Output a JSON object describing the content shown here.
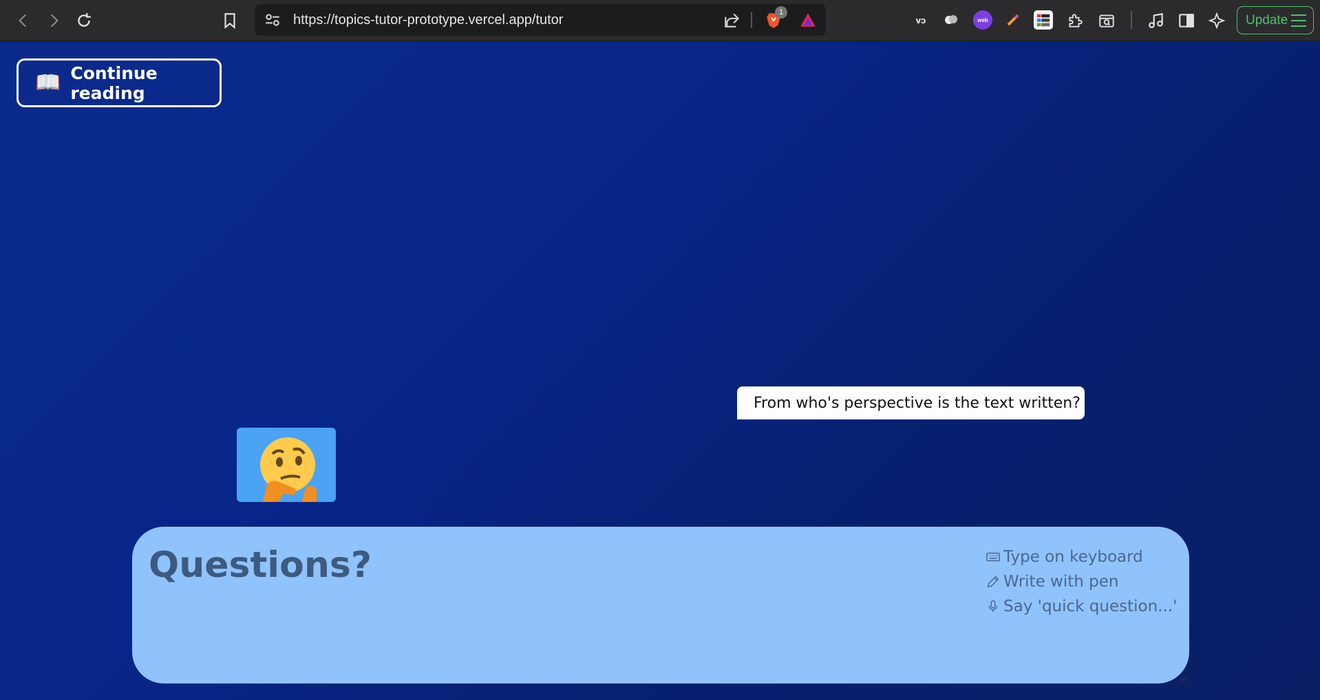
{
  "browser": {
    "url": "https://topics-tutor-prototype.vercel.app/tutor",
    "shields_badge": "1",
    "extensions": [
      "vd-icon",
      "cloud-extension-icon",
      "web-to-figma-icon",
      "color-picker-icon",
      "app-grid-extension-icon",
      "puzzle-extensions-icon",
      "screenshot-search-icon"
    ],
    "update_label": "Update"
  },
  "page": {
    "continue_label": "Continue reading",
    "chat_bubble": "From who's perspective is the text written?",
    "avatar_emoji": "🤔",
    "question_placeholder": "Questions?",
    "input_hints": [
      {
        "icon": "keyboard-icon",
        "label": "Type on keyboard"
      },
      {
        "icon": "pen-icon",
        "label": "Write with pen"
      },
      {
        "icon": "microphone-icon",
        "label": "Say 'quick question...'"
      }
    ]
  },
  "colors": {
    "page_bg": "#082589",
    "input_bg": "#90c3fb",
    "avatar_bg": "#4aa3f5",
    "update_green": "#4ec26a"
  }
}
